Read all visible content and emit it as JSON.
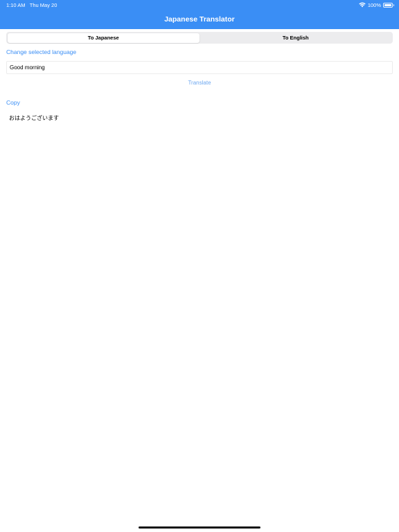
{
  "status_bar": {
    "time": "1:10 AM",
    "date": "Thu May 20",
    "battery": "100%",
    "wifi_icon": "wifi-icon",
    "battery_icon": "battery-full-icon"
  },
  "nav": {
    "title": "Japanese Translator"
  },
  "segmented_control": {
    "segments": [
      {
        "label": "To Japanese",
        "selected": true
      },
      {
        "label": "To English",
        "selected": false
      }
    ]
  },
  "change_language_label": "Change selected language",
  "input": {
    "value": "Good morning"
  },
  "translate_label": "Translate",
  "copy_label": "Copy",
  "output_text": "おはようございます",
  "colors": {
    "header": "#3a8ef5",
    "link": "#3a8ef5",
    "translate_link": "#6ea8f0"
  }
}
